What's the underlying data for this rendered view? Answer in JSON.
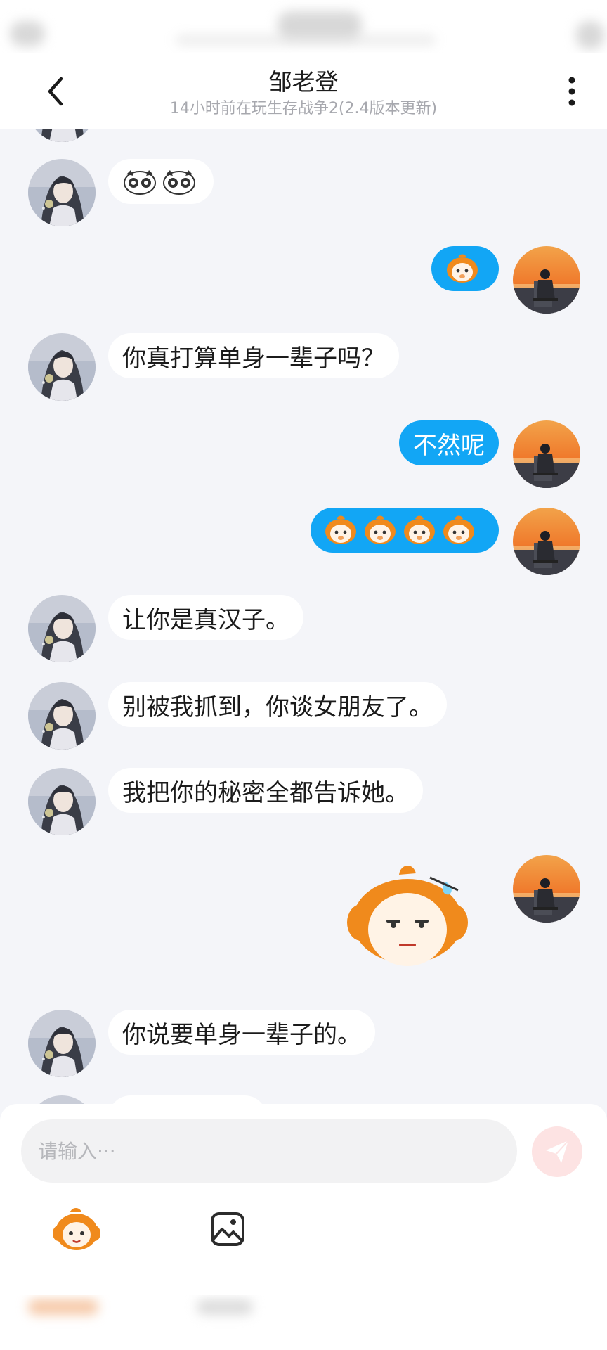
{
  "header": {
    "title": "邹老登",
    "subtitle": "14小时前在玩生存战争2(2.4版本更新)"
  },
  "icons": {
    "back": "chevron-left-icon",
    "more": "more-vertical-icon",
    "send": "send-icon",
    "emoji": "emoji-icon",
    "image": "image-icon"
  },
  "colors": {
    "outgoing_bubble": "#12a6f5",
    "incoming_bubble": "#ffffff",
    "background": "#f4f5f9",
    "sticker_orange": "#f08a1c"
  },
  "messages": [
    {
      "from": "them",
      "kind": "emoji",
      "content": "panda-sticker x2"
    },
    {
      "from": "me",
      "kind": "emoji",
      "content": "orange-laugh-sticker x1"
    },
    {
      "from": "them",
      "kind": "text",
      "text": "你真打算单身一辈子吗？"
    },
    {
      "from": "me",
      "kind": "text",
      "text": "不然呢"
    },
    {
      "from": "me",
      "kind": "emoji",
      "content": "orange-cover-mouth-sticker x4"
    },
    {
      "from": "them",
      "kind": "text",
      "text": "让你是真汉子。"
    },
    {
      "from": "them",
      "kind": "text",
      "text": "别被我抓到，你谈女朋友了。"
    },
    {
      "from": "them",
      "kind": "text",
      "text": "我把你的秘密全都告诉她。"
    },
    {
      "from": "me",
      "kind": "sticker",
      "content": "orange-speechless-big-sticker"
    },
    {
      "from": "them",
      "kind": "text",
      "text": "你说要单身一辈子的。"
    }
  ],
  "composer": {
    "placeholder": "请输入···"
  }
}
